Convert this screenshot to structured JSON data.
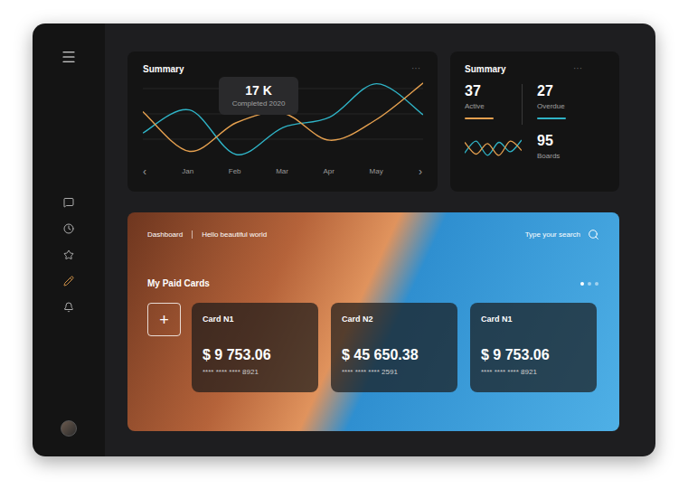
{
  "sidebar": {
    "menu_button": "☰",
    "items": [
      {
        "selected": false
      },
      {
        "selected": false
      },
      {
        "selected": false
      },
      {
        "selected": true
      },
      {
        "selected": false
      }
    ]
  },
  "summary_chart": {
    "title": "Summary",
    "menu": "···",
    "tooltip": {
      "value": "17 K",
      "label": "Completed 2020"
    },
    "months": [
      "Jan",
      "Feb",
      "Mar",
      "Apr",
      "May"
    ],
    "prev": "‹",
    "next": "›",
    "series": [
      {
        "color": "#2fb3c6",
        "values": [
          35,
          64,
          8,
          42,
          55,
          97,
          58
        ]
      },
      {
        "color": "#e5a04f",
        "values": [
          62,
          12,
          48,
          60,
          26,
          52,
          98
        ]
      }
    ]
  },
  "stats": {
    "title": "Summary",
    "menu": "···",
    "items": [
      {
        "value": "37",
        "label": "Active",
        "color": "#e5a04f"
      },
      {
        "value": "27",
        "label": "Overdue",
        "color": "#2fb3c6"
      }
    ],
    "boards": {
      "value": "95",
      "label": "Boards"
    },
    "mini_series": [
      {
        "color": "#2fb3c6",
        "values": [
          30,
          80,
          20,
          75,
          35,
          85
        ]
      },
      {
        "color": "#e5a04f",
        "values": [
          75,
          25,
          70,
          20,
          80,
          40
        ]
      }
    ]
  },
  "banner": {
    "breadcrumbs": [
      "Dashboard",
      "Hello beautiful world"
    ],
    "search": {
      "placeholder": "Type your search"
    },
    "heading": "My Paid Cards",
    "pages": [
      {
        "selected": true
      },
      {
        "selected": false
      },
      {
        "selected": false
      }
    ],
    "add_button": "+",
    "cards": [
      {
        "name": "Card N1",
        "amount": "$ 9 753.06",
        "number": "**** **** **** 8921"
      },
      {
        "name": "Card N2",
        "amount": "$ 45 650.38",
        "number": "**** **** **** 2591"
      },
      {
        "name": "Card N1",
        "amount": "$ 9 753.06",
        "number": "**** **** **** 8921"
      }
    ]
  }
}
